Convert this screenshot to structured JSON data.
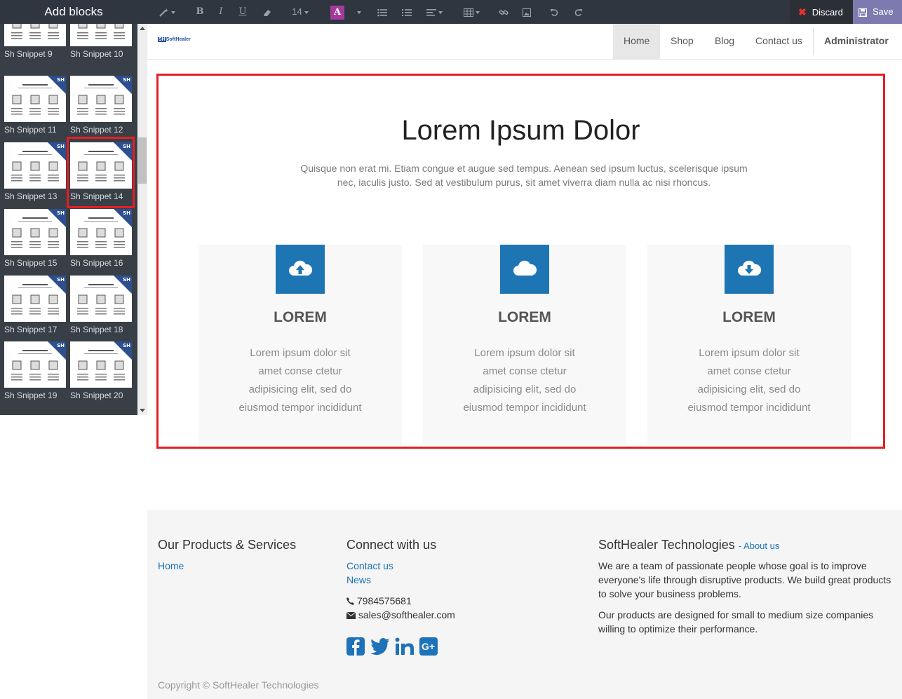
{
  "editor": {
    "sidebar_title": "Add blocks",
    "font_size": "14",
    "discard_label": "Discard",
    "save_label": "Save",
    "colors": {
      "bar": "#2f3640",
      "save": "#7d7ab0",
      "text_color_swatch": "#a43a9b"
    }
  },
  "sidebar": {
    "snippets": [
      {
        "label": "Sh Snippet 9"
      },
      {
        "label": "Sh Snippet 10"
      },
      {
        "label": "Sh Snippet 11"
      },
      {
        "label": "Sh Snippet 12"
      },
      {
        "label": "Sh Snippet 13"
      },
      {
        "label": "Sh Snippet 14",
        "selected": true
      },
      {
        "label": "Sh Snippet 15"
      },
      {
        "label": "Sh Snippet 16"
      },
      {
        "label": "Sh Snippet 17"
      },
      {
        "label": "Sh Snippet 18"
      },
      {
        "label": "Sh Snippet 19"
      },
      {
        "label": "Sh Snippet 20"
      }
    ]
  },
  "site": {
    "logo_text": "SoftHealer",
    "nav": {
      "home": "Home",
      "shop": "Shop",
      "blog": "Blog",
      "contact": "Contact us",
      "admin": "Administrator"
    }
  },
  "snippet": {
    "title": "Lorem Ipsum Dolor",
    "subtitle": "Quisque non erat mi. Etiam congue et augue sed tempus. Aenean sed ipsum luctus, scelerisque ipsum nec, iaculis justo. Sed at vestibulum purus, sit amet viverra diam nulla ac nisi rhoncus.",
    "cards": [
      {
        "icon": "cloud-upload-icon",
        "title": "LOREM",
        "text": "Lorem ipsum dolor sit amet conse ctetur adipisicing elit, sed do eiusmod tempor incididunt"
      },
      {
        "icon": "cloud-icon",
        "title": "LOREM",
        "text": "Lorem ipsum dolor sit amet conse ctetur adipisicing elit, sed do eiusmod tempor incididunt"
      },
      {
        "icon": "cloud-download-icon",
        "title": "LOREM",
        "text": "Lorem ipsum dolor sit amet conse ctetur adipisicing elit, sed do eiusmod tempor incididunt"
      }
    ]
  },
  "footer": {
    "col1": {
      "heading": "Our Products & Services",
      "link_home": "Home"
    },
    "col2": {
      "heading": "Connect with us",
      "link_contact": "Contact us",
      "link_news": "News",
      "phone": "7984575681",
      "email": "sales@softhealer.com"
    },
    "col3": {
      "heading": "SoftHealer Technologies",
      "about_link": "About us",
      "para1": "We are a team of passionate people whose goal is to improve everyone's life through disruptive products. We build great products to solve your business problems.",
      "para2": "Our products are designed for small to medium size companies willing to optimize their performance."
    },
    "copyright": "Copyright © SoftHealer Technologies"
  }
}
